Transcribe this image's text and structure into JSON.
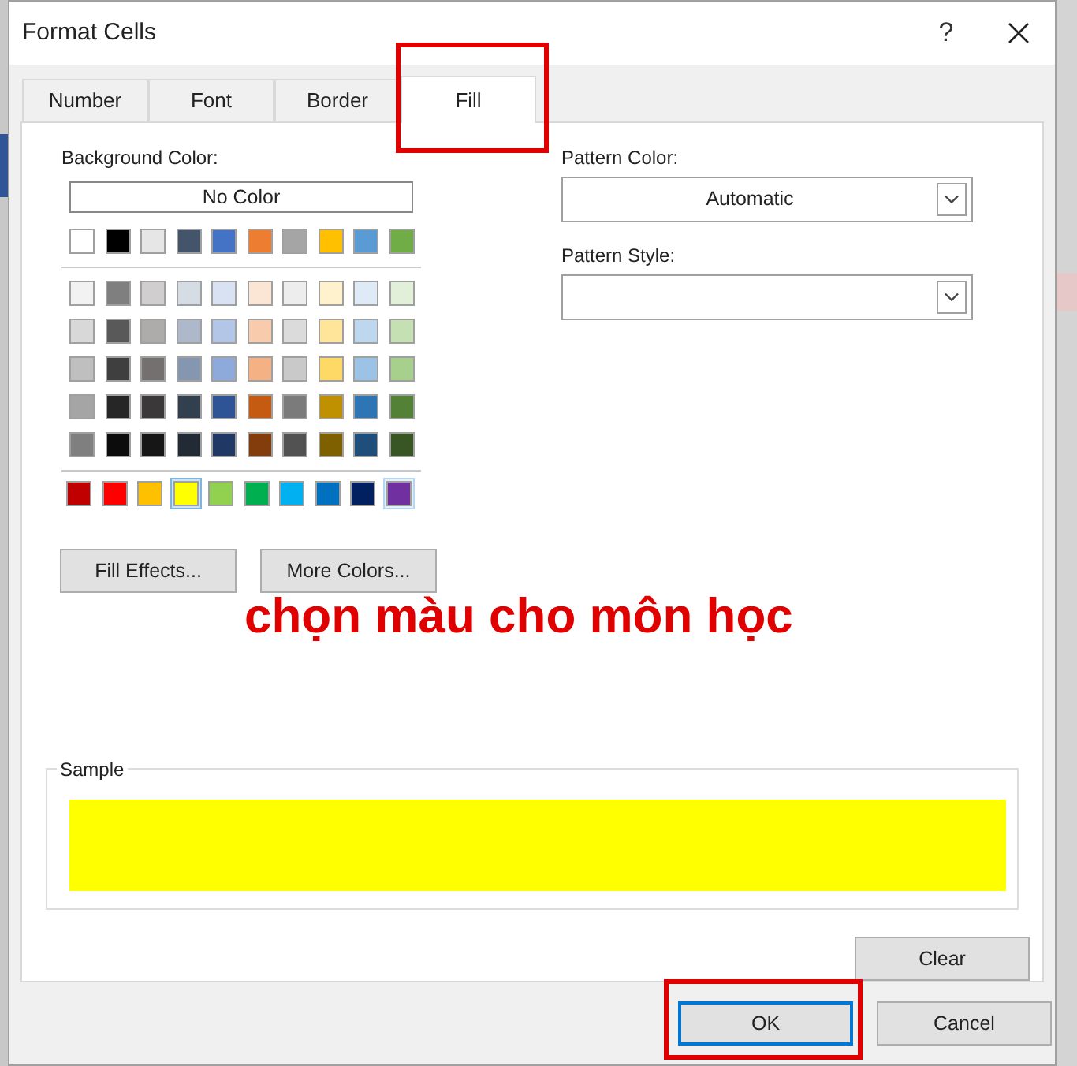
{
  "window": {
    "title": "Format Cells",
    "help": "?"
  },
  "tabs": [
    {
      "label": "Number",
      "selected": false
    },
    {
      "label": "Font",
      "selected": false
    },
    {
      "label": "Border",
      "selected": false
    },
    {
      "label": "Fill",
      "selected": true
    }
  ],
  "background_color": {
    "label": "Background Color:",
    "no_color": "No Color",
    "theme_row": [
      {
        "color": "#ffffff"
      },
      {
        "color": "#000000"
      },
      {
        "color": "#e7e6e6"
      },
      {
        "color": "#44546a"
      },
      {
        "color": "#4472c4"
      },
      {
        "color": "#ed7d31"
      },
      {
        "color": "#a5a5a5"
      },
      {
        "color": "#ffc000"
      },
      {
        "color": "#5b9bd5"
      },
      {
        "color": "#70ad47"
      }
    ],
    "shade_rows": [
      [
        {
          "color": "#f2f2f2"
        },
        {
          "color": "#7f7f7f"
        },
        {
          "color": "#d0cece"
        },
        {
          "color": "#d6dce4"
        },
        {
          "color": "#d9e2f3"
        },
        {
          "color": "#fbe5d5"
        },
        {
          "color": "#ededed"
        },
        {
          "color": "#fff2cc"
        },
        {
          "color": "#deebf6"
        },
        {
          "color": "#e2efd9"
        }
      ],
      [
        {
          "color": "#d8d8d8"
        },
        {
          "color": "#595959"
        },
        {
          "color": "#aeabab"
        },
        {
          "color": "#adb9ca"
        },
        {
          "color": "#b4c6e7"
        },
        {
          "color": "#f7cbac"
        },
        {
          "color": "#dbdbdb"
        },
        {
          "color": "#fee599"
        },
        {
          "color": "#bdd7ee"
        },
        {
          "color": "#c5e0b3"
        }
      ],
      [
        {
          "color": "#bfbfbf"
        },
        {
          "color": "#3f3f3f"
        },
        {
          "color": "#757070"
        },
        {
          "color": "#8496b0"
        },
        {
          "color": "#8eaadb"
        },
        {
          "color": "#f4b183"
        },
        {
          "color": "#c9c9c9"
        },
        {
          "color": "#ffd965"
        },
        {
          "color": "#9cc3e5"
        },
        {
          "color": "#a8d08d"
        }
      ],
      [
        {
          "color": "#a5a5a5"
        },
        {
          "color": "#262626"
        },
        {
          "color": "#3a3838"
        },
        {
          "color": "#323f4f"
        },
        {
          "color": "#2f5496"
        },
        {
          "color": "#c55a11"
        },
        {
          "color": "#7b7b7b"
        },
        {
          "color": "#bf9000"
        },
        {
          "color": "#2e75b5"
        },
        {
          "color": "#538135"
        }
      ],
      [
        {
          "color": "#7f7f7f"
        },
        {
          "color": "#0c0c0c"
        },
        {
          "color": "#171616"
        },
        {
          "color": "#222a35"
        },
        {
          "color": "#1f3864"
        },
        {
          "color": "#833c0b"
        },
        {
          "color": "#525252"
        },
        {
          "color": "#7f6000"
        },
        {
          "color": "#1e4e79"
        },
        {
          "color": "#375623"
        }
      ]
    ],
    "standard_row": [
      {
        "color": "#c00000",
        "selected": false,
        "highlighted": false
      },
      {
        "color": "#ff0000",
        "selected": false,
        "highlighted": false
      },
      {
        "color": "#ffc000",
        "selected": false,
        "highlighted": false
      },
      {
        "color": "#ffff00",
        "selected": true,
        "highlighted": false
      },
      {
        "color": "#92d050",
        "selected": false,
        "highlighted": false
      },
      {
        "color": "#00b050",
        "selected": false,
        "highlighted": false
      },
      {
        "color": "#00b0f0",
        "selected": false,
        "highlighted": false
      },
      {
        "color": "#0070c0",
        "selected": false,
        "highlighted": false
      },
      {
        "color": "#002060",
        "selected": false,
        "highlighted": false
      },
      {
        "color": "#7030a0",
        "selected": false,
        "highlighted": true
      }
    ],
    "buttons": [
      "Fill Effects...",
      "More Colors..."
    ]
  },
  "pattern_color": {
    "label": "Pattern Color:",
    "value": "Automatic"
  },
  "pattern_style": {
    "label": "Pattern Style:"
  },
  "sample": {
    "label": "Sample",
    "color": "#ffff00"
  },
  "clear_button": "Clear",
  "buttons": [
    "OK",
    "Cancel"
  ],
  "annotation": "chọn màu cho môn học"
}
